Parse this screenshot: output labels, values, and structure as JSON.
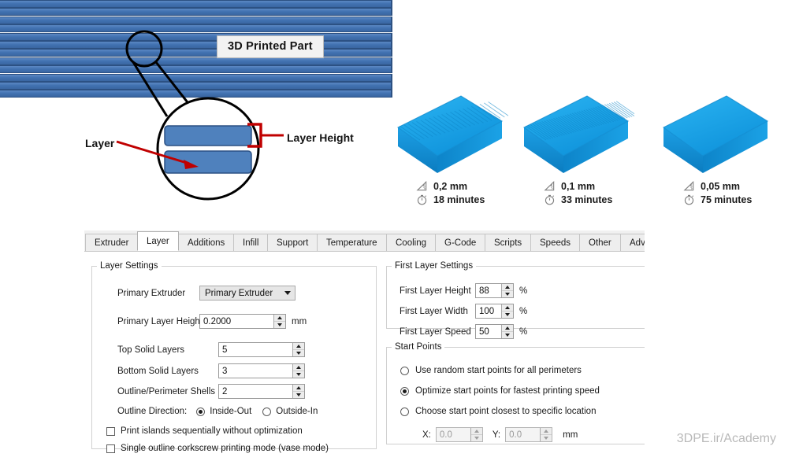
{
  "illustration": {
    "part_label": "3D Printed Part",
    "layer_label": "Layer",
    "layer_height_label": "Layer Height",
    "stripe_count": 12,
    "stripe_color": "#4272b2",
    "stripe_border_color": "#2c5183",
    "callout_color": "#c00000"
  },
  "samples": [
    {
      "name": "sample-0-2mm",
      "layer_height": "0,2 mm",
      "print_time": "18 minutes",
      "height_icon": "ruler-triangle-icon",
      "time_icon": "stopwatch-icon",
      "ridges": 22,
      "color": "#1ea2e8"
    },
    {
      "name": "sample-0-1mm",
      "layer_height": "0,1 mm",
      "print_time": "33 minutes",
      "height_icon": "ruler-triangle-icon",
      "time_icon": "stopwatch-icon",
      "ridges": 40,
      "color": "#1ea2e8"
    },
    {
      "name": "sample-0-05mm",
      "layer_height": "0,05 mm",
      "print_time": "75 minutes",
      "height_icon": "ruler-triangle-icon",
      "time_icon": "stopwatch-icon",
      "ridges": 0,
      "color": "#14a5ef"
    }
  ],
  "dialog": {
    "tabs": [
      {
        "label": "Extruder",
        "active": false
      },
      {
        "label": "Layer",
        "active": true
      },
      {
        "label": "Additions",
        "active": false
      },
      {
        "label": "Infill",
        "active": false
      },
      {
        "label": "Support",
        "active": false
      },
      {
        "label": "Temperature",
        "active": false
      },
      {
        "label": "Cooling",
        "active": false
      },
      {
        "label": "G-Code",
        "active": false
      },
      {
        "label": "Scripts",
        "active": false
      },
      {
        "label": "Speeds",
        "active": false
      },
      {
        "label": "Other",
        "active": false
      },
      {
        "label": "Advanc",
        "active": false
      }
    ],
    "layer_settings": {
      "legend": "Layer Settings",
      "primary_extruder_label": "Primary Extruder",
      "primary_extruder_value": "Primary Extruder",
      "primary_layer_height_label": "Primary Layer Height",
      "primary_layer_height_value": "0.2000",
      "primary_layer_height_unit": "mm",
      "top_solid_layers_label": "Top Solid Layers",
      "top_solid_layers_value": "5",
      "bottom_solid_layers_label": "Bottom Solid Layers",
      "bottom_solid_layers_value": "3",
      "outline_shells_label": "Outline/Perimeter Shells",
      "outline_shells_value": "2",
      "outline_direction_label": "Outline Direction:",
      "outline_inside_out": "Inside-Out",
      "outline_outside_in": "Outside-In",
      "outline_selected": "Inside-Out",
      "print_islands_label": "Print islands sequentially without optimization",
      "print_islands_checked": false,
      "vase_mode_label": "Single outline corkscrew printing mode (vase mode)",
      "vase_mode_checked": false
    },
    "first_layer_settings": {
      "legend": "First Layer Settings",
      "height_label": "First Layer Height",
      "height_value": "88",
      "height_unit": "%",
      "width_label": "First Layer Width",
      "width_value": "100",
      "width_unit": "%",
      "speed_label": "First Layer Speed",
      "speed_value": "50",
      "speed_unit": "%"
    },
    "start_points": {
      "legend": "Start Points",
      "random_label": "Use random start points for all perimeters",
      "optimize_label": "Optimize start points for fastest printing speed",
      "closest_label": "Choose start point closest to specific location",
      "selected": "Optimize start points for fastest printing speed",
      "x_label": "X:",
      "x_value": "0.0",
      "y_label": "Y:",
      "y_value": "0.0",
      "xy_unit": "mm"
    }
  },
  "watermark": "3DPE.ir/Academy"
}
